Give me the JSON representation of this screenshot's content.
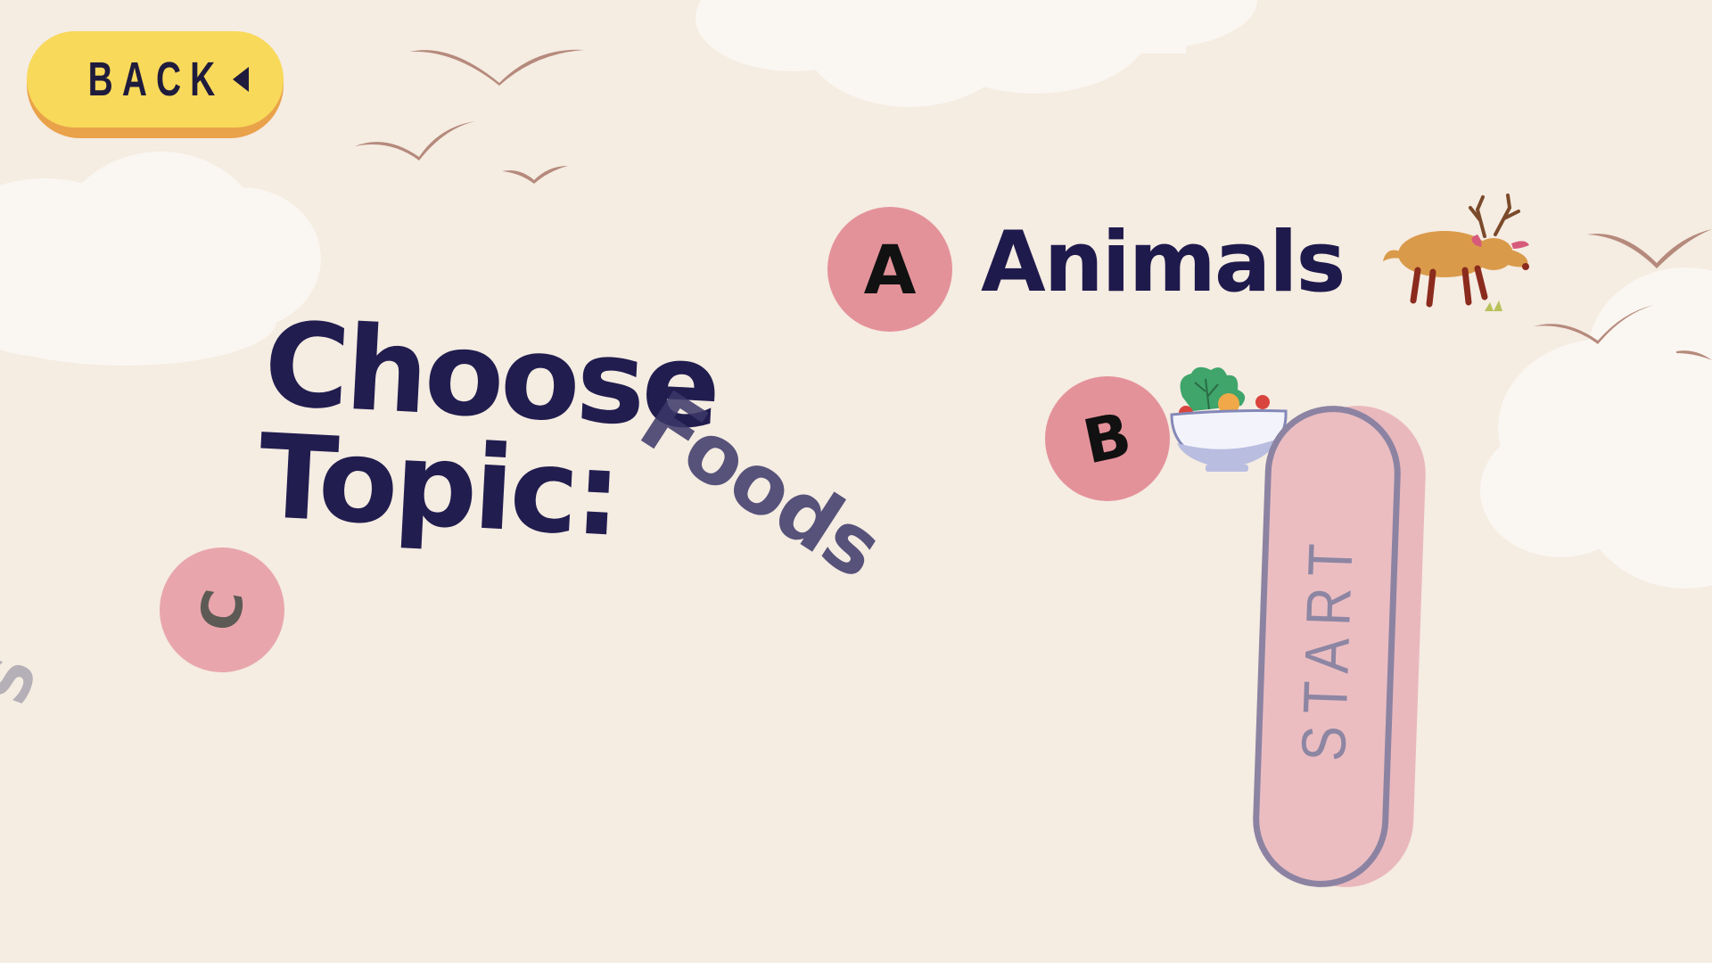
{
  "header": {
    "back_label": "BACK"
  },
  "title": {
    "line1": "Choose",
    "line2": "Topic:"
  },
  "options": [
    {
      "letter": "A",
      "label": "Animals",
      "icon": "deer-icon"
    },
    {
      "letter": "B",
      "label": "Foods",
      "icon": "salad-bowl-icon"
    },
    {
      "letter": "C",
      "label": "",
      "icon": ""
    }
  ],
  "stray_letter": "S",
  "start": {
    "label": "START"
  },
  "colors": {
    "background": "#f5ece2",
    "title": "#211d4f",
    "circle": "#e4929a",
    "back_button": "#f8d95a",
    "bird": "#b58a7c"
  }
}
